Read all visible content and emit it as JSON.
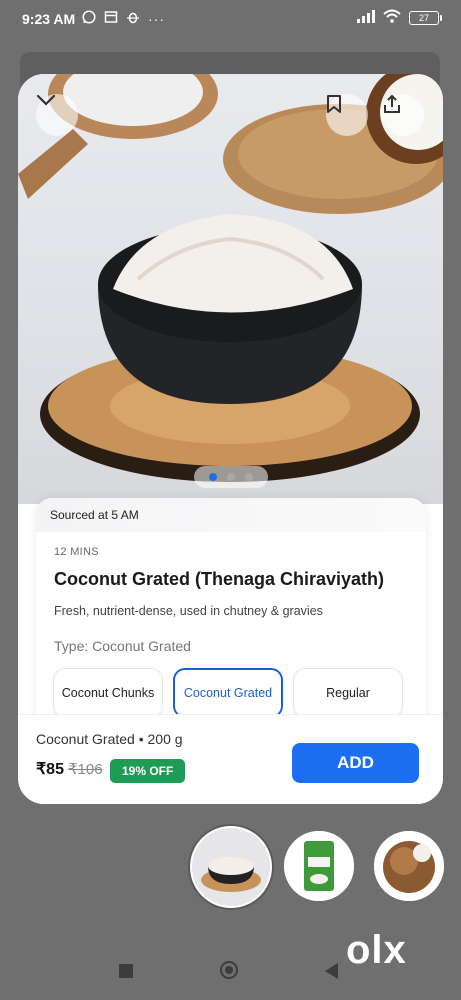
{
  "status_bar": {
    "time": "9:23 AM",
    "battery": "27"
  },
  "product": {
    "sourced": "Sourced at 5 AM",
    "eta": "12 MINS",
    "title": "Coconut Grated (Thenaga Chiraviyath)",
    "description": "Fresh, nutrient-dense, used in chutney & gravies",
    "type_label": "Type: Coconut Grated",
    "variants": [
      {
        "label": "Coconut Chunks",
        "selected": false
      },
      {
        "label": "Coconut Grated",
        "selected": true
      },
      {
        "label": "Regular",
        "selected": false
      }
    ],
    "image_carousel": {
      "count": 3,
      "active": 0
    }
  },
  "footer": {
    "name": "Coconut Grated • 200 g",
    "price": "₹85",
    "mrp": "₹106",
    "discount": "19% OFF",
    "add_label": "ADD"
  },
  "watermark": "olx",
  "colors": {
    "accent": "#1d6ff2",
    "discount": "#1e9b55",
    "selected_border": "#1e5fd0"
  },
  "icons": [
    "chevron-down-icon",
    "bookmark-icon",
    "share-icon",
    "whatsapp-icon",
    "signal-icon",
    "wifi-icon",
    "battery-icon"
  ]
}
